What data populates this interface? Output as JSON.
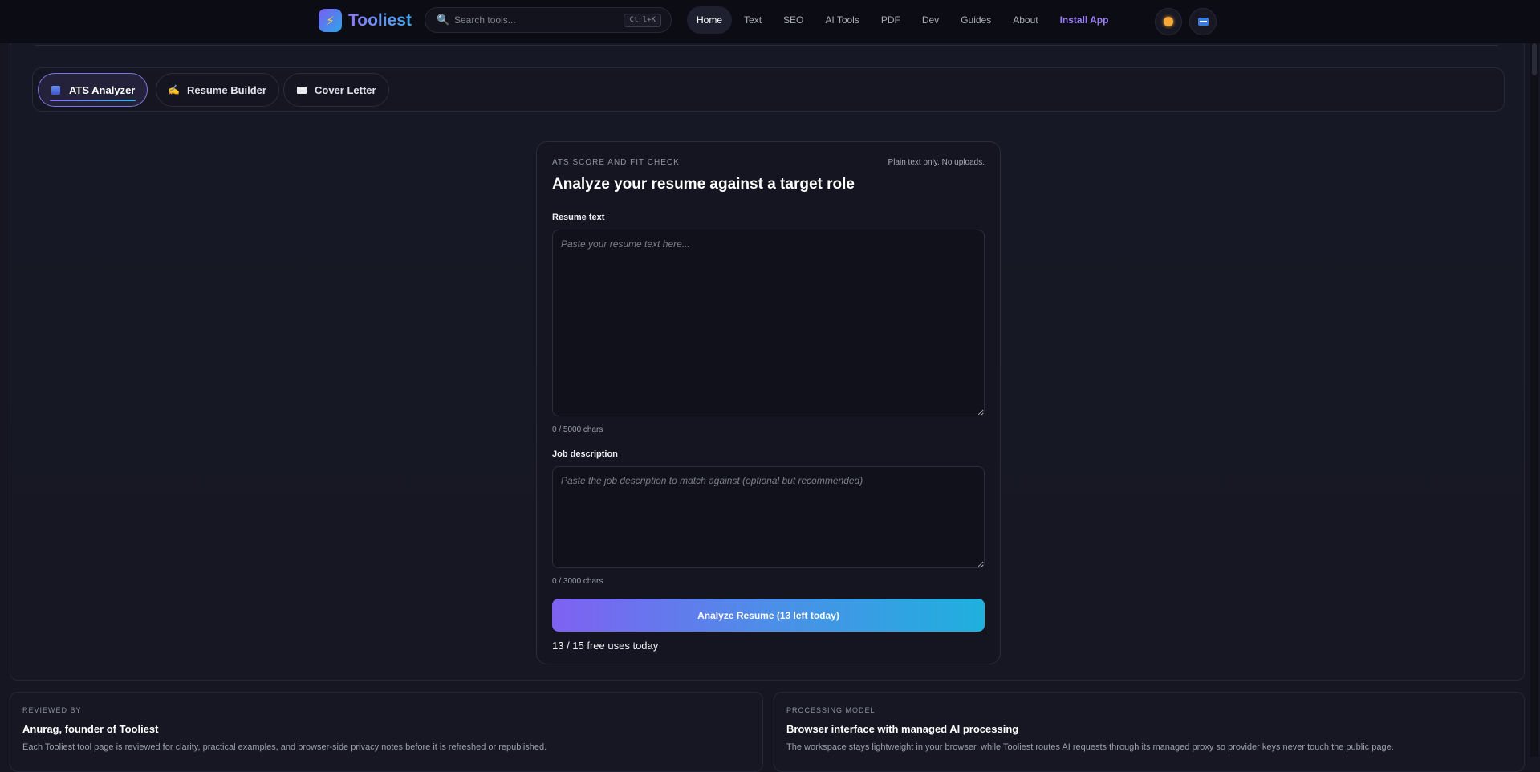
{
  "header": {
    "brand": "Tooliest",
    "logo_glyph": "⚡",
    "search": {
      "placeholder": "Search tools...",
      "value": "",
      "shortcut": "Ctrl+K"
    },
    "nav": [
      {
        "label": "Home",
        "active": true
      },
      {
        "label": "Text"
      },
      {
        "label": "SEO"
      },
      {
        "label": "AI Tools"
      },
      {
        "label": "PDF"
      },
      {
        "label": "Dev"
      },
      {
        "label": "Guides"
      },
      {
        "label": "About"
      },
      {
        "label": "Install App"
      }
    ],
    "icons": {
      "theme": "sun-icon",
      "language": "flag-icon"
    }
  },
  "tabs": [
    {
      "label": "ATS Analyzer",
      "icon": "📊",
      "active": true
    },
    {
      "label": "Resume Builder",
      "icon": "✍️"
    },
    {
      "label": "Cover Letter",
      "icon": "✉️"
    }
  ],
  "card": {
    "eyebrow": "ATS SCORE AND FIT CHECK",
    "note": "Plain text only. No uploads.",
    "title": "Analyze your resume against a target role",
    "resume": {
      "label": "Resume text",
      "placeholder": "Paste your resume text here...",
      "value": "",
      "counter": "0 / 5000 chars"
    },
    "job": {
      "label": "Job description",
      "placeholder": "Paste the job description to match against (optional but recommended)",
      "value": "",
      "counter": "0 / 3000 chars"
    },
    "button": "Analyze Resume (13 left today)",
    "uses": "13 / 15 free uses today"
  },
  "info": [
    {
      "eyebrow": "REVIEWED BY",
      "title": "Anurag, founder of Tooliest",
      "body": "Each Tooliest tool page is reviewed for clarity, practical examples, and browser-side privacy notes before it is refreshed or republished."
    },
    {
      "eyebrow": "PROCESSING MODEL",
      "title": "Browser interface with managed AI processing",
      "body": "The workspace stays lightweight in your browser, while Tooliest routes AI requests through its managed proxy so provider keys never touch the public page."
    }
  ],
  "colors": {
    "accent_purple": "#7f61f2",
    "accent_cyan": "#1fb0de",
    "install_link": "#9b7cfb",
    "background": "#151621"
  }
}
